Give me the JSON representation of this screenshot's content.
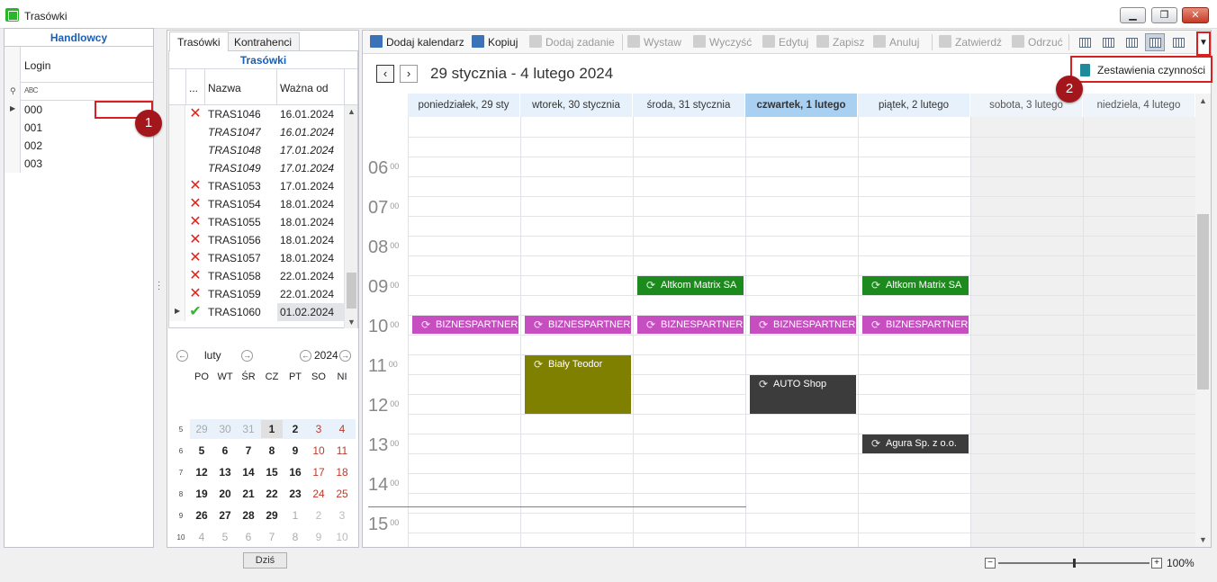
{
  "window": {
    "title": "Trasówki"
  },
  "left_panel": {
    "header": "Handlowcy",
    "column": "Login",
    "filter_icon_text": "ABC",
    "rows": [
      "000",
      "001",
      "002",
      "003"
    ]
  },
  "markers": {
    "one": "1",
    "two": "2"
  },
  "middle_panel": {
    "tabs": [
      "Trasówki",
      "Kontrahenci"
    ],
    "grid_title": "Trasówki",
    "columns": {
      "dots": "...",
      "name": "Nazwa",
      "valid_from": "Ważna od"
    },
    "rows": [
      {
        "status": "x",
        "name": "TRAS1046",
        "date": "16.01.2024",
        "italic": false
      },
      {
        "status": "",
        "name": "TRAS1047",
        "date": "16.01.2024",
        "italic": true
      },
      {
        "status": "",
        "name": "TRAS1048",
        "date": "17.01.2024",
        "italic": true
      },
      {
        "status": "",
        "name": "TRAS1049",
        "date": "17.01.2024",
        "italic": true
      },
      {
        "status": "x",
        "name": "TRAS1053",
        "date": "17.01.2024",
        "italic": false
      },
      {
        "status": "x",
        "name": "TRAS1054",
        "date": "18.01.2024",
        "italic": false
      },
      {
        "status": "x",
        "name": "TRAS1055",
        "date": "18.01.2024",
        "italic": false
      },
      {
        "status": "x",
        "name": "TRAS1056",
        "date": "18.01.2024",
        "italic": false
      },
      {
        "status": "x",
        "name": "TRAS1057",
        "date": "18.01.2024",
        "italic": false
      },
      {
        "status": "x",
        "name": "TRAS1058",
        "date": "22.01.2024",
        "italic": false
      },
      {
        "status": "x",
        "name": "TRAS1059",
        "date": "22.01.2024",
        "italic": false
      },
      {
        "status": "ok",
        "name": "TRAS1060",
        "date": "01.02.2024",
        "italic": false
      }
    ]
  },
  "mini_calendar": {
    "month": "luty",
    "year": "2024",
    "dow": [
      "PO",
      "WT",
      "ŚR",
      "CZ",
      "PT",
      "SO",
      "NI"
    ],
    "weeks": [
      {
        "wk": "5",
        "days": [
          "29",
          "30",
          "31",
          "1",
          "2",
          "3",
          "4"
        ]
      },
      {
        "wk": "6",
        "days": [
          "5",
          "6",
          "7",
          "8",
          "9",
          "10",
          "11"
        ]
      },
      {
        "wk": "7",
        "days": [
          "12",
          "13",
          "14",
          "15",
          "16",
          "17",
          "18"
        ]
      },
      {
        "wk": "8",
        "days": [
          "19",
          "20",
          "21",
          "22",
          "23",
          "24",
          "25"
        ]
      },
      {
        "wk": "9",
        "days": [
          "26",
          "27",
          "28",
          "29",
          "1",
          "2",
          "3"
        ]
      },
      {
        "wk": "10",
        "days": [
          "4",
          "5",
          "6",
          "7",
          "8",
          "9",
          "10"
        ]
      }
    ],
    "today_button": "Dziś"
  },
  "toolbar": {
    "buttons": [
      {
        "label": "Dodaj kalendarz",
        "enabled": true
      },
      {
        "label": "Kopiuj",
        "enabled": true
      },
      {
        "label": "Dodaj zadanie",
        "enabled": false
      },
      {
        "label": "Wystaw",
        "enabled": false
      },
      {
        "label": "Wyczyść",
        "enabled": false
      },
      {
        "label": "Edytuj",
        "enabled": false
      },
      {
        "label": "Zapisz",
        "enabled": false
      },
      {
        "label": "Anuluj",
        "enabled": false
      },
      {
        "label": "Zatwierdź",
        "enabled": false
      },
      {
        "label": "Odrzuć",
        "enabled": false
      }
    ],
    "menu_item": "Zestawienia czynności"
  },
  "scheduler": {
    "range_title": "29 stycznia - 4 lutego 2024",
    "days": [
      "poniedziałek, 29 sty",
      "wtorek, 30 stycznia",
      "środa, 31 stycznia",
      "czwartek, 1 lutego",
      "piątek, 2 lutego",
      "sobota, 3 lutego",
      "niedziela, 4 lutego"
    ],
    "hours": [
      "06",
      "07",
      "08",
      "09",
      "10",
      "11",
      "12",
      "13",
      "14",
      "15"
    ],
    "minutes_label": "00",
    "appointments": [
      {
        "day": 2,
        "start": 9.0,
        "end": 9.5,
        "title": "Altkom Matrix SA",
        "color": "#1d8a1d"
      },
      {
        "day": 4,
        "start": 9.0,
        "end": 9.5,
        "title": "Altkom Matrix SA",
        "color": "#1d8a1d"
      },
      {
        "day": 0,
        "start": 10.0,
        "end": 10.25,
        "title": "BIZNESPARTNER.",
        "color": "#c74ec1"
      },
      {
        "day": 1,
        "start": 10.0,
        "end": 10.25,
        "title": "BIZNESPARTNER.",
        "color": "#c74ec1"
      },
      {
        "day": 2,
        "start": 10.0,
        "end": 10.25,
        "title": "BIZNESPARTNER.",
        "color": "#c74ec1"
      },
      {
        "day": 3,
        "start": 10.0,
        "end": 10.25,
        "title": "BIZNESPARTNER.",
        "color": "#c74ec1"
      },
      {
        "day": 4,
        "start": 10.0,
        "end": 10.25,
        "title": "BIZNESPARTNER.",
        "color": "#c74ec1"
      },
      {
        "day": 1,
        "start": 11.0,
        "end": 12.5,
        "title": "Biały Teodor",
        "color": "#7f7f00"
      },
      {
        "day": 3,
        "start": 11.5,
        "end": 12.5,
        "title": "AUTO Shop",
        "color": "#3c3c3c"
      },
      {
        "day": 4,
        "start": 13.0,
        "end": 13.5,
        "title": "Agura Sp. z o.o.",
        "color": "#3c3c3c"
      }
    ]
  },
  "zoom": {
    "value": "100%",
    "minus": "−",
    "plus": "+"
  }
}
